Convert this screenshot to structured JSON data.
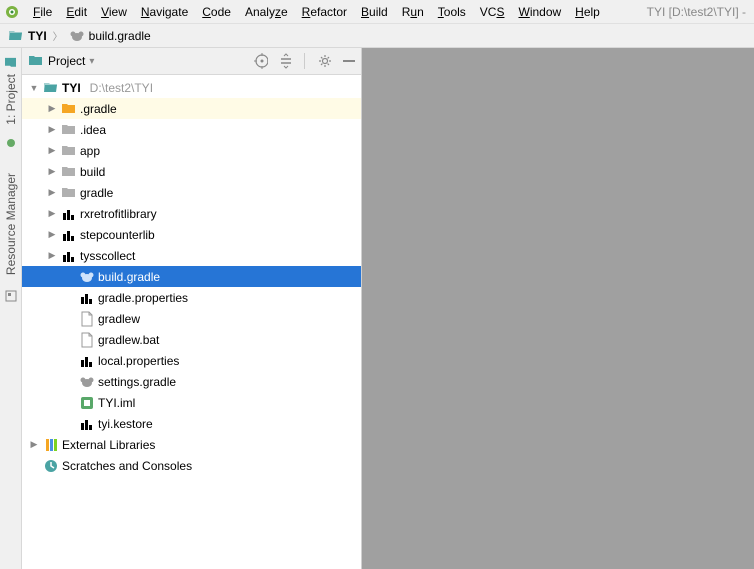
{
  "window": {
    "title": "TYI [D:\\test2\\TYI] -"
  },
  "menu": {
    "file": "File",
    "edit": "Edit",
    "view": "View",
    "navigate": "Navigate",
    "code": "Code",
    "analyze": "Analyze",
    "refactor": "Refactor",
    "build": "Build",
    "run": "Run",
    "tools": "Tools",
    "vcs": "VCS",
    "window": "Window",
    "help": "Help"
  },
  "breadcrumb": {
    "root": "TYI",
    "file": "build.gradle"
  },
  "left_tabs": {
    "project": "1: Project",
    "resource": "Resource Manager"
  },
  "project_panel": {
    "title": "Project"
  },
  "tree": {
    "root": {
      "name": "TYI",
      "hint": "D:\\test2\\TYI"
    },
    "items": [
      {
        "label": ".gradle"
      },
      {
        "label": ".idea"
      },
      {
        "label": "app"
      },
      {
        "label": "build"
      },
      {
        "label": "gradle"
      },
      {
        "label": "rxretrofitlibrary"
      },
      {
        "label": "stepcounterlib"
      },
      {
        "label": "tysscollect"
      },
      {
        "label": "build.gradle"
      },
      {
        "label": "gradle.properties"
      },
      {
        "label": "gradlew"
      },
      {
        "label": "gradlew.bat"
      },
      {
        "label": "local.properties"
      },
      {
        "label": "settings.gradle"
      },
      {
        "label": "TYI.iml"
      },
      {
        "label": "tyi.kestore"
      }
    ],
    "ext_lib": "External Libraries",
    "scratches": "Scratches and Consoles"
  }
}
